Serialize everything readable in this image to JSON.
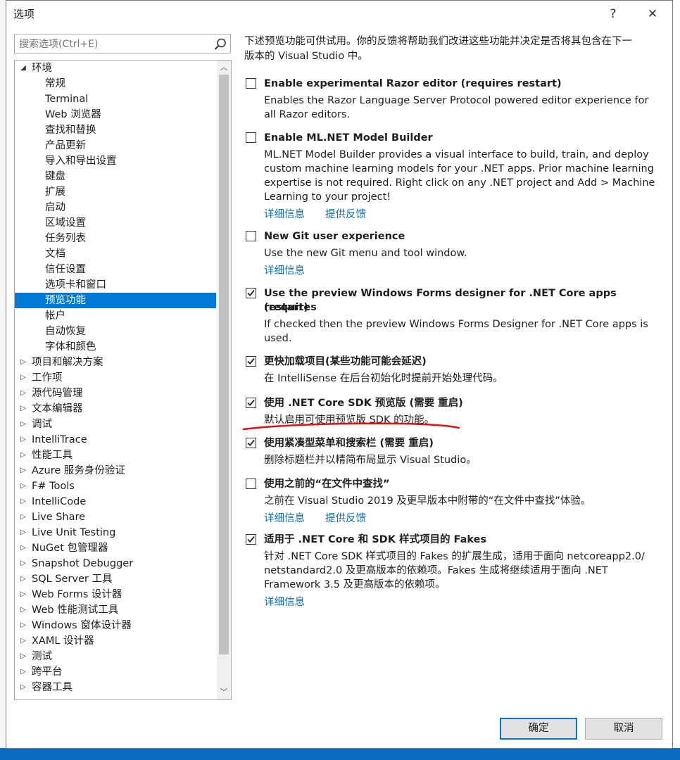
{
  "dialog": {
    "title": "选项",
    "help_label": "?",
    "close_label": "✕"
  },
  "search": {
    "placeholder": "搜索选项(Ctrl+E)"
  },
  "tree": {
    "items": [
      {
        "label": "环境",
        "level": 0,
        "expanded": true
      },
      {
        "label": "常规",
        "level": 1
      },
      {
        "label": "Terminal",
        "level": 1
      },
      {
        "label": "Web 浏览器",
        "level": 1
      },
      {
        "label": "查找和替换",
        "level": 1
      },
      {
        "label": "产品更新",
        "level": 1
      },
      {
        "label": "导入和导出设置",
        "level": 1
      },
      {
        "label": "键盘",
        "level": 1
      },
      {
        "label": "扩展",
        "level": 1
      },
      {
        "label": "启动",
        "level": 1
      },
      {
        "label": "区域设置",
        "level": 1
      },
      {
        "label": "任务列表",
        "level": 1
      },
      {
        "label": "文档",
        "level": 1
      },
      {
        "label": "信任设置",
        "level": 1
      },
      {
        "label": "选项卡和窗口",
        "level": 1
      },
      {
        "label": "预览功能",
        "level": 1,
        "selected": true
      },
      {
        "label": "帐户",
        "level": 1
      },
      {
        "label": "自动恢复",
        "level": 1
      },
      {
        "label": "字体和颜色",
        "level": 1
      },
      {
        "label": "项目和解决方案",
        "level": 0
      },
      {
        "label": "工作项",
        "level": 0
      },
      {
        "label": "源代码管理",
        "level": 0
      },
      {
        "label": "文本编辑器",
        "level": 0
      },
      {
        "label": "调试",
        "level": 0
      },
      {
        "label": "IntelliTrace",
        "level": 0
      },
      {
        "label": "性能工具",
        "level": 0
      },
      {
        "label": "Azure 服务身份验证",
        "level": 0
      },
      {
        "label": "F# Tools",
        "level": 0
      },
      {
        "label": "IntelliCode",
        "level": 0
      },
      {
        "label": "Live Share",
        "level": 0
      },
      {
        "label": "Live Unit Testing",
        "level": 0
      },
      {
        "label": "NuGet 包管理器",
        "level": 0
      },
      {
        "label": "Snapshot Debugger",
        "level": 0
      },
      {
        "label": "SQL Server 工具",
        "level": 0
      },
      {
        "label": "Web Forms 设计器",
        "level": 0
      },
      {
        "label": "Web 性能测试工具",
        "level": 0
      },
      {
        "label": "Windows 窗体设计器",
        "level": 0
      },
      {
        "label": "XAML 设计器",
        "level": 0
      },
      {
        "label": "测试",
        "level": 0
      },
      {
        "label": "跨平台",
        "level": 0
      },
      {
        "label": "容器工具",
        "level": 0
      }
    ]
  },
  "main": {
    "intro_line1": "下述预览功能可供试用。你的反馈将帮助我们改进这些功能并决定是否将其包含在下一",
    "intro_line2": "版本的 Visual Studio 中。",
    "options": [
      {
        "checked": false,
        "title": [
          "Enable experimental Razor editor (requires restart)"
        ],
        "desc": [
          "Enables the Razor Language Server Protocol powered editor experience for",
          "all Razor editors."
        ],
        "links": []
      },
      {
        "checked": false,
        "title": [
          "Enable ML.NET Model Builder"
        ],
        "desc": [
          "ML.NET Model Builder provides a visual interface to build, train, and deploy",
          "custom machine learning models for your .NET apps. Prior machine learning",
          "expertise is not required. Right click on any .NET project and Add > Machine",
          "Learning to your project!"
        ],
        "links": [
          "详细信息",
          "提供反馈"
        ]
      },
      {
        "checked": false,
        "title": [
          "New Git user experience"
        ],
        "desc": [
          "Use the new Git menu and tool window."
        ],
        "links": [
          "详细信息"
        ]
      },
      {
        "checked": true,
        "title": [
          "Use the preview Windows Forms designer for .NET Core apps (requires",
          "restart)"
        ],
        "desc": [
          "If checked then the preview Windows Forms Designer for .NET Core apps is",
          "used."
        ],
        "links": []
      },
      {
        "checked": true,
        "title": [
          "更快加载项目(某些功能可能会延迟)"
        ],
        "desc": [
          "在 IntelliSense 在后台初始化时提前开始处理代码。"
        ],
        "links": []
      },
      {
        "checked": true,
        "title": [
          "使用 .NET Core SDK 预览版 (需要 重启)"
        ],
        "desc": [
          "默认启用可使用预览版 SDK 的功能。"
        ],
        "links": []
      },
      {
        "checked": true,
        "title": [
          "使用紧凑型菜单和搜索栏 (需要 重启)"
        ],
        "desc": [
          "删除标题栏并以精简布局显示 Visual Studio。"
        ],
        "links": []
      },
      {
        "checked": false,
        "title": [
          "使用之前的“在文件中查找”"
        ],
        "desc": [
          "之前在 Visual Studio 2019 及更早版本中附带的“在文件中查找”体验。"
        ],
        "links": [
          "详细信息",
          "提供反馈"
        ]
      },
      {
        "checked": true,
        "title": [
          "适用于 .NET Core 和 SDK 样式项目的 Fakes"
        ],
        "desc": [
          "针对 .NET Core SDK 样式项目的 Fakes 的扩展生成，适用于面向 netcoreapp2.0/",
          "netstandard2.0 及更高版本的依赖项。Fakes 生成将继续适用于面向 .NET",
          "Framework 3.5 及更高版本的依赖项。"
        ],
        "links": [
          "详细信息"
        ]
      }
    ]
  },
  "buttons": {
    "ok": "确定",
    "cancel": "取消"
  },
  "colors": {
    "accent": "#0078d7",
    "link": "#0e70c0",
    "annotation": "#e01010"
  }
}
